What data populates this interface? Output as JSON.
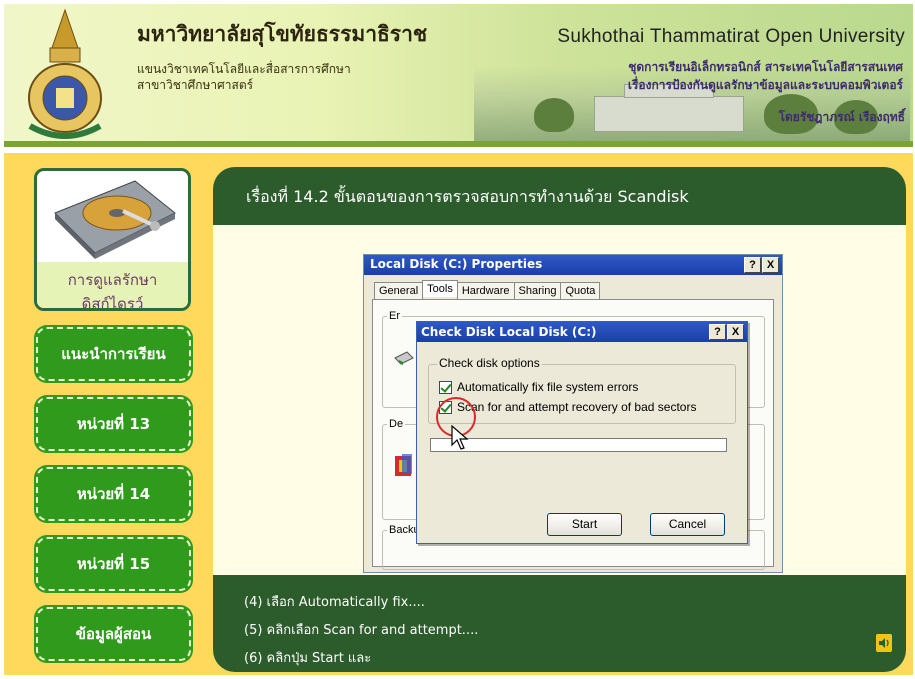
{
  "header": {
    "th_title": "มหาวิทยาลัยสุโขทัยธรรมาธิราช",
    "th_sub1": "แขนงวิชาเทคโนโลยีและสื่อสารการศึกษา",
    "th_sub2": "สาขาวิชาศึกษาศาสตร์",
    "en_title": "Sukhothai Thammatirat Open University",
    "en_sub1": "ชุดการเรียนอิเล็กทรอนิกส์ สาระเทคโนโลยีสารสนเทศ",
    "en_sub2": "เรื่องการป้องกันดูแลรักษาข้อมูลและระบบคอมพิวเตอร์",
    "author": "โดยรัชฎาภรณ์ เรืองฤทธิ์"
  },
  "sidebar": {
    "hdd_caption_line1": "การดูแลรักษา",
    "hdd_caption_line2": "ดิสก์ไดรว์",
    "items": [
      {
        "label": "แนะนำการเรียน"
      },
      {
        "label": "หน่วยที่ 13"
      },
      {
        "label": "หน่วยที่ 14"
      },
      {
        "label": "หน่วยที่ 15"
      },
      {
        "label": "ข้อมูลผู้สอน"
      }
    ]
  },
  "main": {
    "title": "เรื่องที่ 14.2 ขั้นตอนของการตรวจสอบการทำงานด้วย Scandisk",
    "steps": [
      "(4) เลือก Automatically fix....",
      "(5) คลิกเลือก Scan for and attempt....",
      "(6) คลิกปุ่ม Start และ"
    ]
  },
  "properties_dialog": {
    "title": "Local Disk (C:) Properties",
    "help_btn": "?",
    "close_btn": "X",
    "tabs": [
      "General",
      "Tools",
      "Hardware",
      "Sharing",
      "Quota"
    ],
    "group_error": "Er",
    "group_defrag": "De",
    "group_backup": "Backup"
  },
  "checkdisk_dialog": {
    "title": "Check Disk Local Disk (C:)",
    "help_btn": "?",
    "close_btn": "X",
    "group_label": "Check disk options",
    "option1": "Automatically fix file system errors",
    "option2": "Scan for and attempt recovery of bad sectors",
    "start": "Start",
    "cancel": "Cancel"
  },
  "colors": {
    "panel_green": "#2c5c2c",
    "nav_green": "#2f9a1c",
    "background_yellow": "#ffd95c",
    "highlight_circle": "#d92a2a"
  }
}
